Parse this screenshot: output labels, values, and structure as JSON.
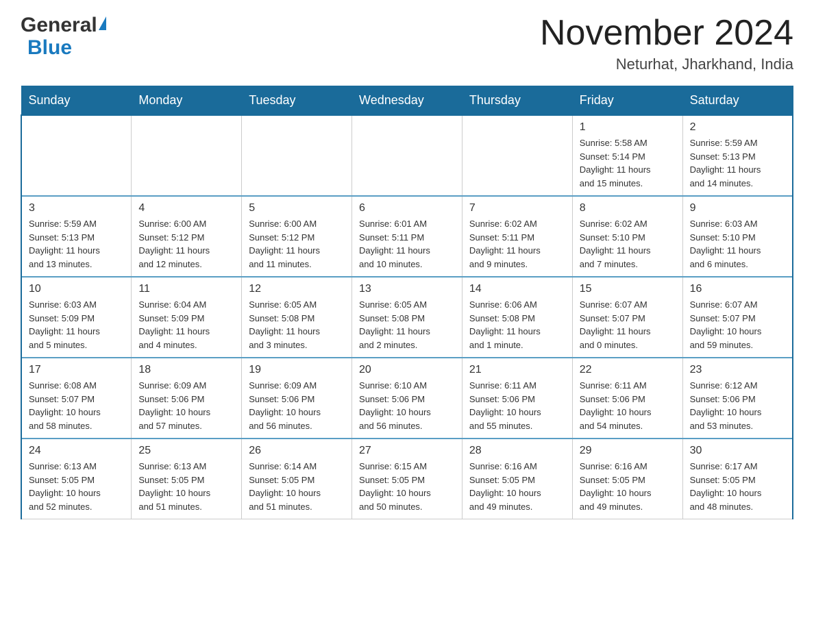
{
  "logo": {
    "general": "General",
    "blue": "Blue"
  },
  "title": {
    "month_year": "November 2024",
    "location": "Neturhat, Jharkhand, India"
  },
  "weekdays": [
    "Sunday",
    "Monday",
    "Tuesday",
    "Wednesday",
    "Thursday",
    "Friday",
    "Saturday"
  ],
  "weeks": [
    [
      {
        "day": "",
        "info": ""
      },
      {
        "day": "",
        "info": ""
      },
      {
        "day": "",
        "info": ""
      },
      {
        "day": "",
        "info": ""
      },
      {
        "day": "",
        "info": ""
      },
      {
        "day": "1",
        "info": "Sunrise: 5:58 AM\nSunset: 5:14 PM\nDaylight: 11 hours\nand 15 minutes."
      },
      {
        "day": "2",
        "info": "Sunrise: 5:59 AM\nSunset: 5:13 PM\nDaylight: 11 hours\nand 14 minutes."
      }
    ],
    [
      {
        "day": "3",
        "info": "Sunrise: 5:59 AM\nSunset: 5:13 PM\nDaylight: 11 hours\nand 13 minutes."
      },
      {
        "day": "4",
        "info": "Sunrise: 6:00 AM\nSunset: 5:12 PM\nDaylight: 11 hours\nand 12 minutes."
      },
      {
        "day": "5",
        "info": "Sunrise: 6:00 AM\nSunset: 5:12 PM\nDaylight: 11 hours\nand 11 minutes."
      },
      {
        "day": "6",
        "info": "Sunrise: 6:01 AM\nSunset: 5:11 PM\nDaylight: 11 hours\nand 10 minutes."
      },
      {
        "day": "7",
        "info": "Sunrise: 6:02 AM\nSunset: 5:11 PM\nDaylight: 11 hours\nand 9 minutes."
      },
      {
        "day": "8",
        "info": "Sunrise: 6:02 AM\nSunset: 5:10 PM\nDaylight: 11 hours\nand 7 minutes."
      },
      {
        "day": "9",
        "info": "Sunrise: 6:03 AM\nSunset: 5:10 PM\nDaylight: 11 hours\nand 6 minutes."
      }
    ],
    [
      {
        "day": "10",
        "info": "Sunrise: 6:03 AM\nSunset: 5:09 PM\nDaylight: 11 hours\nand 5 minutes."
      },
      {
        "day": "11",
        "info": "Sunrise: 6:04 AM\nSunset: 5:09 PM\nDaylight: 11 hours\nand 4 minutes."
      },
      {
        "day": "12",
        "info": "Sunrise: 6:05 AM\nSunset: 5:08 PM\nDaylight: 11 hours\nand 3 minutes."
      },
      {
        "day": "13",
        "info": "Sunrise: 6:05 AM\nSunset: 5:08 PM\nDaylight: 11 hours\nand 2 minutes."
      },
      {
        "day": "14",
        "info": "Sunrise: 6:06 AM\nSunset: 5:08 PM\nDaylight: 11 hours\nand 1 minute."
      },
      {
        "day": "15",
        "info": "Sunrise: 6:07 AM\nSunset: 5:07 PM\nDaylight: 11 hours\nand 0 minutes."
      },
      {
        "day": "16",
        "info": "Sunrise: 6:07 AM\nSunset: 5:07 PM\nDaylight: 10 hours\nand 59 minutes."
      }
    ],
    [
      {
        "day": "17",
        "info": "Sunrise: 6:08 AM\nSunset: 5:07 PM\nDaylight: 10 hours\nand 58 minutes."
      },
      {
        "day": "18",
        "info": "Sunrise: 6:09 AM\nSunset: 5:06 PM\nDaylight: 10 hours\nand 57 minutes."
      },
      {
        "day": "19",
        "info": "Sunrise: 6:09 AM\nSunset: 5:06 PM\nDaylight: 10 hours\nand 56 minutes."
      },
      {
        "day": "20",
        "info": "Sunrise: 6:10 AM\nSunset: 5:06 PM\nDaylight: 10 hours\nand 56 minutes."
      },
      {
        "day": "21",
        "info": "Sunrise: 6:11 AM\nSunset: 5:06 PM\nDaylight: 10 hours\nand 55 minutes."
      },
      {
        "day": "22",
        "info": "Sunrise: 6:11 AM\nSunset: 5:06 PM\nDaylight: 10 hours\nand 54 minutes."
      },
      {
        "day": "23",
        "info": "Sunrise: 6:12 AM\nSunset: 5:06 PM\nDaylight: 10 hours\nand 53 minutes."
      }
    ],
    [
      {
        "day": "24",
        "info": "Sunrise: 6:13 AM\nSunset: 5:05 PM\nDaylight: 10 hours\nand 52 minutes."
      },
      {
        "day": "25",
        "info": "Sunrise: 6:13 AM\nSunset: 5:05 PM\nDaylight: 10 hours\nand 51 minutes."
      },
      {
        "day": "26",
        "info": "Sunrise: 6:14 AM\nSunset: 5:05 PM\nDaylight: 10 hours\nand 51 minutes."
      },
      {
        "day": "27",
        "info": "Sunrise: 6:15 AM\nSunset: 5:05 PM\nDaylight: 10 hours\nand 50 minutes."
      },
      {
        "day": "28",
        "info": "Sunrise: 6:16 AM\nSunset: 5:05 PM\nDaylight: 10 hours\nand 49 minutes."
      },
      {
        "day": "29",
        "info": "Sunrise: 6:16 AM\nSunset: 5:05 PM\nDaylight: 10 hours\nand 49 minutes."
      },
      {
        "day": "30",
        "info": "Sunrise: 6:17 AM\nSunset: 5:05 PM\nDaylight: 10 hours\nand 48 minutes."
      }
    ]
  ]
}
